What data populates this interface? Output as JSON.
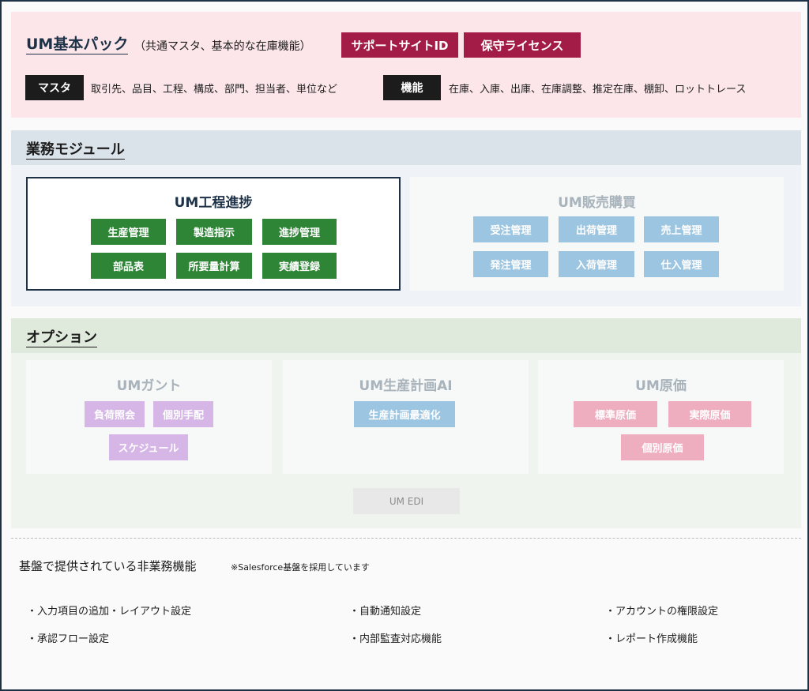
{
  "basic": {
    "title": "UM基本パック",
    "subtitle": "（共通マスタ、基本的な在庫機能）",
    "tags": [
      "サポートサイトID",
      "保守ライセンス"
    ],
    "master_label": "マスタ",
    "master_text": "取引先、品目、工程、構成、部門、担当者、単位など",
    "function_label": "機能",
    "function_text": "在庫、入庫、出庫、在庫調整、推定在庫、棚卸、ロットトレース"
  },
  "gyomu": {
    "title": "業務モジュール",
    "koutei": {
      "title": "UM工程進捗",
      "items": [
        "生産管理",
        "製造指示",
        "進捗管理",
        "部品表",
        "所要量計算",
        "実績登録"
      ]
    },
    "hanbai": {
      "title": "UM販売購買",
      "items": [
        "受注管理",
        "出荷管理",
        "売上管理",
        "発注管理",
        "入荷管理",
        "仕入管理"
      ]
    }
  },
  "option": {
    "title": "オプション",
    "gantt": {
      "title": "UMガント",
      "items": [
        "負荷照会",
        "個別手配",
        "スケジュール"
      ]
    },
    "ai": {
      "title": "UM生産計画AI",
      "items": [
        "生産計画最適化"
      ]
    },
    "genka": {
      "title": "UM原価",
      "items": [
        "標準原価",
        "実際原価",
        "個別原価"
      ]
    },
    "edi": "UM EDI"
  },
  "non_business": {
    "title": "基盤で提供されている非業務機能",
    "note": "※Salesforce基盤を採用しています",
    "items": [
      "・入力項目の追加・レイアウト設定",
      "・自動通知設定",
      "・アカウントの権限設定",
      "・承認フロー設定",
      "・内部監査対応機能",
      "・レポート作成機能"
    ]
  },
  "colors": {
    "navy": "#1d3147",
    "crimson": "#a31c48",
    "green": "#2e8536",
    "light_blue": "#9cc5e2",
    "purple": "#d5b6e7",
    "pink": "#efadc0",
    "muted_title": "#a8b3bb"
  }
}
